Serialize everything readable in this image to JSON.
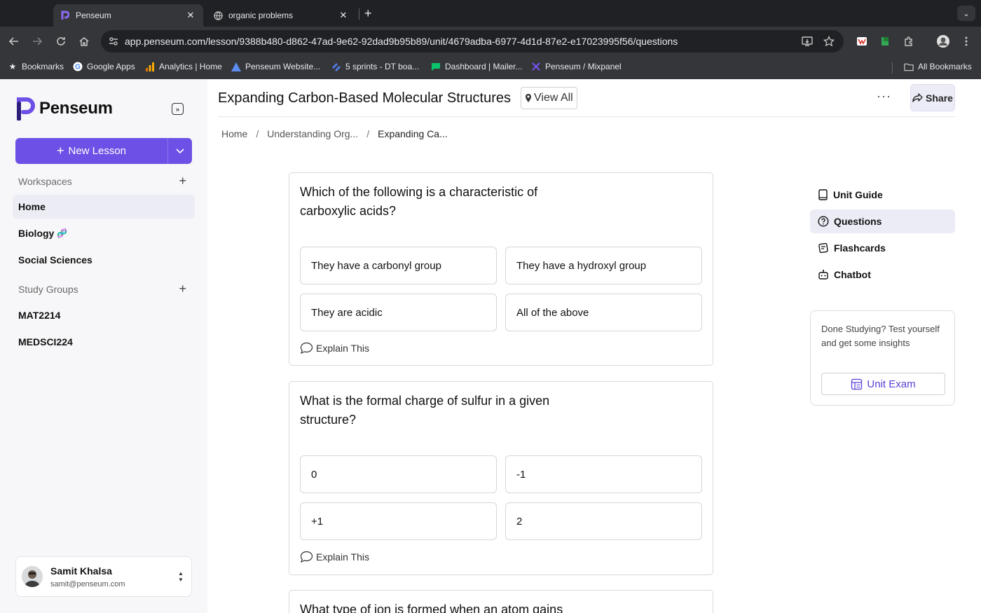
{
  "browser": {
    "tabs": [
      {
        "title": "Penseum",
        "active": true
      },
      {
        "title": "organic problems",
        "active": false
      }
    ],
    "url": "app.penseum.com/lesson/9388b480-d862-47ad-9e62-92dad9b95b89/unit/4679adba-6977-4d1d-87e2-e17023995f56/questions",
    "bookmarks": [
      "Bookmarks",
      "Google Apps",
      "Analytics | Home",
      "Penseum Website...",
      "5 sprints - DT boa...",
      "Dashboard | Mailer...",
      "Penseum / Mixpanel"
    ],
    "all_bookmarks": "All Bookmarks"
  },
  "sidebar": {
    "logo": "Penseum",
    "new_lesson": "New Lesson",
    "workspaces_label": "Workspaces",
    "workspaces": [
      "Home",
      "Biology",
      "Social Sciences"
    ],
    "biology_emoji": "🧬",
    "study_groups_label": "Study Groups",
    "study_groups": [
      "MAT2214",
      "MEDSCI224"
    ],
    "user": {
      "name": "Samit Khalsa",
      "email": "samit@penseum.com"
    }
  },
  "header": {
    "title": "Expanding Carbon-Based Molecular Structures",
    "view_all": "View All",
    "share": "Share",
    "more": "···"
  },
  "breadcrumb": [
    "Home",
    "Understanding Org...",
    "Expanding Ca..."
  ],
  "questions": [
    {
      "text": "Which of the following is a characteristic of carboxylic acids?",
      "options": [
        "They have a carbonyl group",
        "They have a hydroxyl group",
        "They are acidic",
        "All of the above"
      ],
      "explain": "Explain This"
    },
    {
      "text": "What is the formal charge of sulfur in a given structure?",
      "options": [
        "0",
        "-1",
        "+1",
        "2"
      ],
      "explain": "Explain This"
    },
    {
      "text": "What type of ion is formed when an atom gains"
    }
  ],
  "right_nav": [
    "Unit Guide",
    "Questions",
    "Flashcards",
    "Chatbot"
  ],
  "done_card": {
    "text": "Done Studying? Test yourself and get some insights",
    "button": "Unit Exam"
  },
  "colors": {
    "accent": "#6d50e6",
    "chrome_dark": "#202124",
    "chrome_mid": "#35363a"
  }
}
